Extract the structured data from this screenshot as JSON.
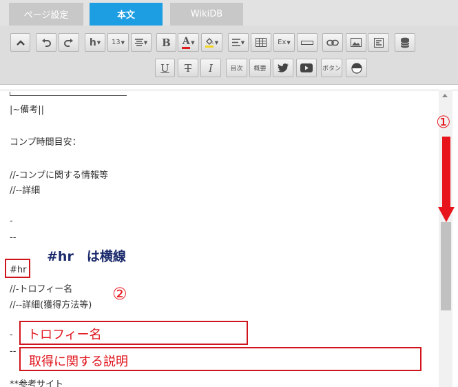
{
  "tabs": [
    {
      "label": "ページ設定"
    },
    {
      "label": "本文"
    },
    {
      "label": "WikiDB"
    }
  ],
  "toolbar": {
    "heading_label": "h",
    "fontsize_label": "13",
    "bold_label": "B",
    "color_label": "A",
    "ex_label": "Ex",
    "toc_label": "目次",
    "summary_label": "概要",
    "button_label": "ボタン"
  },
  "editor": {
    "lines": [
      "|~備考||",
      "コンプ時間目安：",
      "//-コンプに関する情報等",
      "//--詳細",
      "-",
      "--",
      "#hr",
      "//-トロフィー名",
      "//--詳細(獲得方法等)",
      "-",
      "--",
      "**参考サイト"
    ]
  },
  "annotations": {
    "marker1": "①",
    "marker2": "②",
    "hr_note": "#hr　は横線",
    "trophy_name": "トロフィー名",
    "trophy_desc": "取得に関する説明"
  }
}
